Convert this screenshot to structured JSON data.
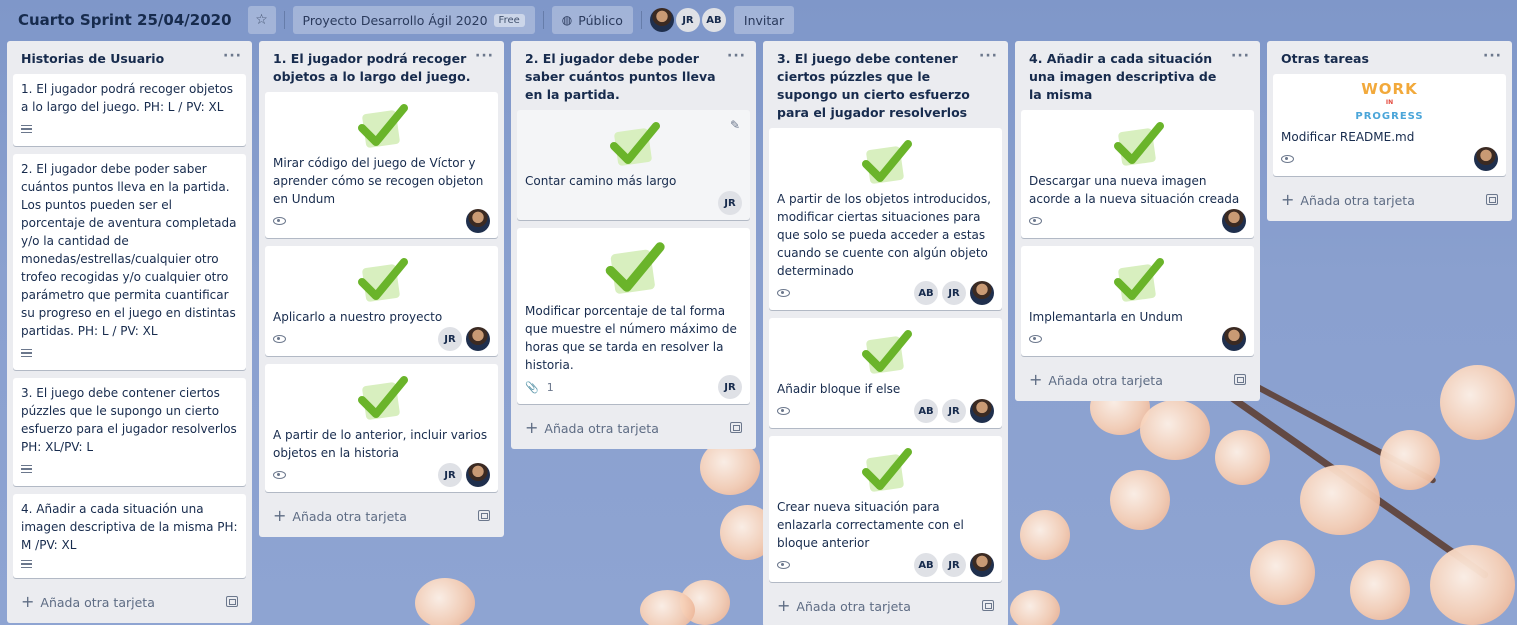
{
  "header": {
    "board_title": "Cuarto Sprint 25/04/2020",
    "team_name": "Proyecto Desarrollo Ágil 2020",
    "team_badge": "Free",
    "visibility": "Público",
    "members": [
      "JR",
      "AB"
    ],
    "invite_label": "Invitar"
  },
  "add_card_label": "Añada otra tarjeta",
  "lists": [
    {
      "title": "Historias de Usuario",
      "cards": [
        {
          "text": "1. El jugador podrá recoger objetos a lo largo del juego. PH: L / PV: XL"
        },
        {
          "text": "2. El jugador debe poder saber cuántos puntos lleva en la partida. Los puntos pueden ser el porcentaje de aventura completada y/o la cantidad de monedas/estrellas/cualquier otro trofeo recogidas y/o cualquier otro parámetro que permita cuantificar su progreso en el juego en distintas partidas. PH: L / PV: XL"
        },
        {
          "text": "3. El juego debe contener ciertos púzzles que le supongo un cierto esfuerzo para el jugador resolverlos PH: XL/PV: L"
        },
        {
          "text": "4. Añadir a cada situación una imagen descriptiva de la misma PH: M /PV: XL"
        }
      ]
    },
    {
      "title": "1. El jugador podrá recoger objetos a lo largo del juego.",
      "cards": [
        {
          "text": "Mirar código del juego de Víctor y aprender cómo se recogen objeton en Undum",
          "members": []
        },
        {
          "text": "Aplicarlo a nuestro proyecto",
          "members": [
            "JR"
          ]
        },
        {
          "text": "A partir de lo anterior, incluir varios objetos en la historia",
          "members": [
            "JR"
          ]
        }
      ]
    },
    {
      "title": "2. El jugador debe poder saber cuántos puntos lleva en la partida.",
      "cards": [
        {
          "text": "Contar camino más largo",
          "members": [
            "JR"
          ]
        },
        {
          "text": "Modificar porcentaje de tal forma que muestre el número máximo de horas que se tarda en resolver la historia.",
          "attachments": "1",
          "members": [
            "JR"
          ]
        }
      ]
    },
    {
      "title": "3. El juego debe contener ciertos púzzles que le supongo un cierto esfuerzo para el jugador resolverlos",
      "cards": [
        {
          "text": "A partir de los objetos introducidos, modificar ciertas situaciones para que solo se pueda acceder a estas cuando se cuente con algún objeto determinado",
          "members": [
            "AB",
            "JR"
          ]
        },
        {
          "text": "Añadir bloque if else",
          "members": [
            "AB",
            "JR"
          ]
        },
        {
          "text": "Crear nueva situación para enlazarla correctamente con el bloque anterior",
          "members": [
            "AB",
            "JR"
          ]
        }
      ]
    },
    {
      "title": "4. Añadir a cada situación una imagen descriptiva de la misma",
      "cards": [
        {
          "text": "Descargar una nueva imagen acorde a la nueva situación creada"
        },
        {
          "text": "Implemantarla en Undum"
        }
      ]
    },
    {
      "title": "Otras tareas",
      "cards": [
        {
          "text": "Modificar README.md",
          "cover": [
            "WORK",
            "IN",
            "PROGRESS"
          ]
        }
      ]
    }
  ]
}
